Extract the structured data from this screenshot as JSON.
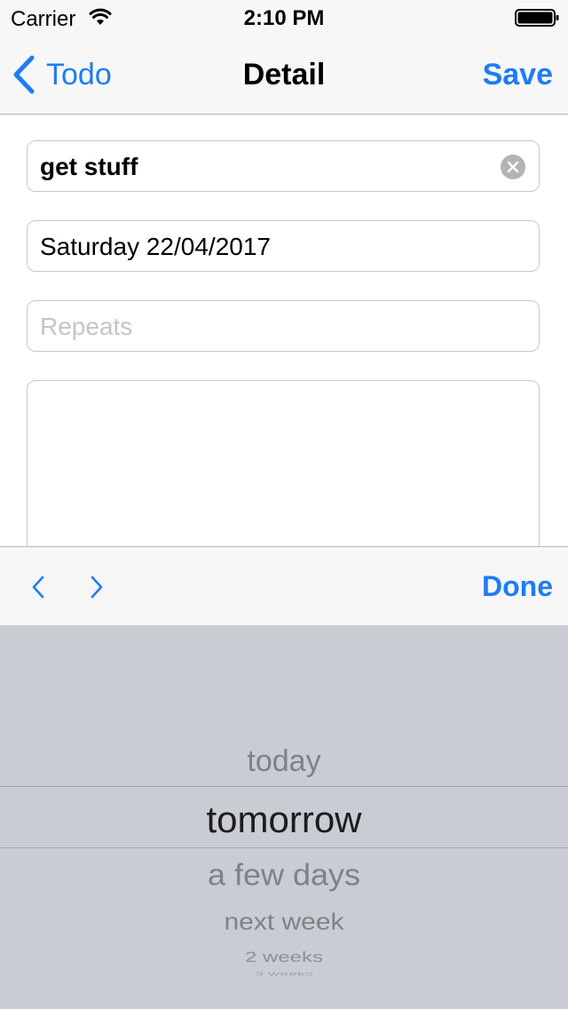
{
  "status_bar": {
    "carrier": "Carrier",
    "time": "2:10 PM"
  },
  "nav": {
    "back_label": "Todo",
    "title": "Detail",
    "save_label": "Save"
  },
  "form": {
    "name_value": "get stuff",
    "date_value": "Saturday 22/04/2017",
    "repeats_placeholder": "Repeats",
    "notes_value": ""
  },
  "toolbar": {
    "done_label": "Done"
  },
  "picker": {
    "options": [
      "today",
      "tomorrow",
      "a few days",
      "next week",
      "2 weeks",
      "3 weeks"
    ],
    "selected": "tomorrow"
  },
  "colors": {
    "accent": "#1f7bf5",
    "picker_bg": "#c9ccd3",
    "bar_bg": "#f7f7f7"
  }
}
